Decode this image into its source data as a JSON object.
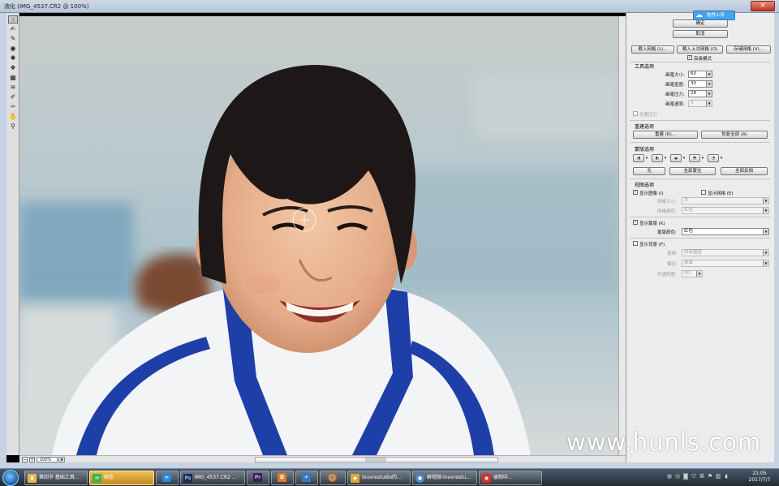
{
  "window": {
    "title": "液化 (IMG_4537.CR2 @ 100%)"
  },
  "colors": {
    "accent": "#4aa3ea",
    "mask": "#d41a1a",
    "jersey_blue": "#1f3fa8"
  },
  "tools": [
    "forward-warp-icon",
    "reconstruct-icon",
    "twirl-icon",
    "pucker-icon",
    "bloat-icon",
    "push-left-icon",
    "mirror-icon",
    "turbulence-icon",
    "freeze-mask-icon",
    "thaw-mask-icon",
    "hand-icon",
    "zoom-icon"
  ],
  "status": {
    "zoom": "100%"
  },
  "badge": {
    "label": "拖拽上传"
  },
  "panel": {
    "ok": "确定",
    "cancel": "取消",
    "load_mesh": "载入网格 (L)...",
    "load_last_mesh": "载入上次网格 (O)",
    "save_mesh": "存储网格 (V)...",
    "advanced_mode": "高级模式",
    "tool_options": {
      "title": "工具选项",
      "brush_size_label": "画笔大小:",
      "brush_size": "60",
      "brush_density_label": "画笔密度:",
      "brush_density": "30",
      "brush_pressure_label": "画笔压力:",
      "brush_pressure": "28",
      "brush_rate_label": "画笔速率:",
      "brush_rate": "0",
      "stylus_pressure": "光笔压力"
    },
    "reconstruct": {
      "title": "重建选项",
      "rebuild": "重建 (R)...",
      "restore_all": "恢复全部 (A)"
    },
    "mask": {
      "title": "蒙版选项",
      "none": "无",
      "mask_all": "全部蒙住",
      "invert_all": "全部反相"
    },
    "view": {
      "title": "视图选项",
      "show_image": "显示图像 (I)",
      "show_mesh": "显示网格 (E)",
      "mesh_size_label": "网格大小:",
      "mesh_size": "大",
      "mesh_color_label": "网格颜色:",
      "mesh_color": "红色",
      "show_mask": "显示蒙版 (K)",
      "mask_color_label": "蒙版颜色:",
      "mask_color": "红色",
      "show_backdrop": "显示背景 (F)",
      "use_label": "使用:",
      "use": "所有图层",
      "mode_label": "模式:",
      "mode": "前面",
      "opacity_label": "不透明度:",
      "opacity": "50"
    }
  },
  "watermark": "www.hunls.com",
  "taskbar": {
    "items": [
      {
        "label": "第四节 基础工具...",
        "icon": "folder-icon",
        "color": "#e8b84a"
      },
      {
        "label": "微信",
        "icon": "wechat-icon",
        "color": "#3bb24a"
      },
      {
        "label": "",
        "icon": "baidu-netdisk-icon",
        "color": "#2a87d8"
      },
      {
        "label": "IMG_4537.CR2 ...",
        "icon": "photoshop-icon",
        "color": "#1b2a4e"
      },
      {
        "label": "",
        "icon": "premiere-icon",
        "color": "#3a1f5a"
      },
      {
        "label": "",
        "icon": "camera-app-icon",
        "color": "#e07a28"
      },
      {
        "label": "",
        "icon": "feather-app-icon",
        "color": "#2d7bd0"
      },
      {
        "label": "",
        "icon": "chrome-icon",
        "color": "#d8473a"
      },
      {
        "label": "louvrestudio的...",
        "icon": "browser-icon",
        "color": "#e3a33a"
      },
      {
        "label": "群视频-louvrestu...",
        "icon": "qq-video-icon",
        "color": "#4a8ad0"
      },
      {
        "label": "录制中...",
        "icon": "record-icon",
        "color": "#d0342a"
      }
    ],
    "time": "21:05",
    "date": "2017/7/7"
  }
}
